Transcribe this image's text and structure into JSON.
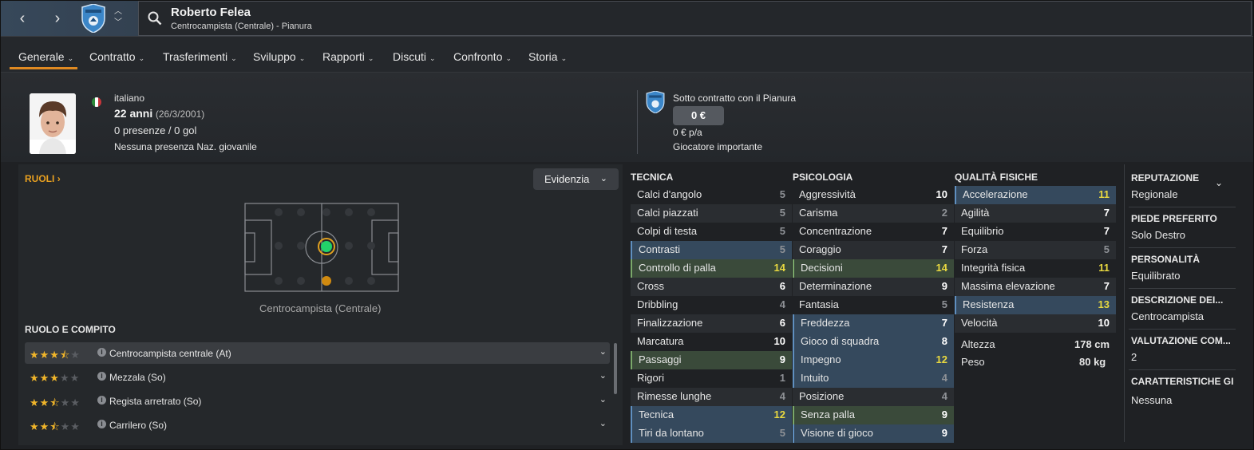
{
  "header": {
    "name": "Roberto Felea",
    "subtitle": "Centrocampista (Centrale) - Pianura"
  },
  "tabs": [
    {
      "label": "Generale"
    },
    {
      "label": "Contratto"
    },
    {
      "label": "Trasferimenti"
    },
    {
      "label": "Sviluppo"
    },
    {
      "label": "Rapporti"
    },
    {
      "label": "Discuti"
    },
    {
      "label": "Confronto"
    },
    {
      "label": "Storia"
    }
  ],
  "bio": {
    "nationality": "italiano",
    "age": "22 anni",
    "dob": "(26/3/2001)",
    "apps": "0 presenze / 0 gol",
    "youth": "Nessuna presenza Naz. giovanile"
  },
  "contract": {
    "club": "Sotto contratto con il Pianura",
    "value": "0 €",
    "wage": "0 € p/a",
    "status": "Giocatore importante"
  },
  "roles": {
    "title": "RUOLI",
    "highlight": "Evidenzia",
    "position_label": "Centrocampista (Centrale)",
    "section_title": "RUOLO E COMPITO",
    "items": [
      {
        "label": "Centrocampista centrale (At)",
        "stars": 3.5
      },
      {
        "label": "Mezzala (So)",
        "stars": 3
      },
      {
        "label": "Regista arretrato (So)",
        "stars": 2.5
      },
      {
        "label": "Carrilero (So)",
        "stars": 2.5
      }
    ]
  },
  "attributes": {
    "tecnica": {
      "title": "TECNICA",
      "items": [
        {
          "name": "Calci d'angolo",
          "value": "5"
        },
        {
          "name": "Calci piazzati",
          "value": "5"
        },
        {
          "name": "Colpi di testa",
          "value": "5"
        },
        {
          "name": "Contrasti",
          "value": "5"
        },
        {
          "name": "Controllo di palla",
          "value": "14"
        },
        {
          "name": "Cross",
          "value": "6"
        },
        {
          "name": "Dribbling",
          "value": "4"
        },
        {
          "name": "Finalizzazione",
          "value": "6"
        },
        {
          "name": "Marcatura",
          "value": "10"
        },
        {
          "name": "Passaggi",
          "value": "9"
        },
        {
          "name": "Rigori",
          "value": "1"
        },
        {
          "name": "Rimesse lunghe",
          "value": "4"
        },
        {
          "name": "Tecnica",
          "value": "12"
        },
        {
          "name": "Tiri da lontano",
          "value": "5"
        }
      ]
    },
    "psicologia": {
      "title": "PSICOLOGIA",
      "items": [
        {
          "name": "Aggressività",
          "value": "10"
        },
        {
          "name": "Carisma",
          "value": "2"
        },
        {
          "name": "Concentrazione",
          "value": "7"
        },
        {
          "name": "Coraggio",
          "value": "7"
        },
        {
          "name": "Decisioni",
          "value": "14"
        },
        {
          "name": "Determinazione",
          "value": "9"
        },
        {
          "name": "Fantasia",
          "value": "5"
        },
        {
          "name": "Freddezza",
          "value": "7"
        },
        {
          "name": "Gioco di squadra",
          "value": "8"
        },
        {
          "name": "Impegno",
          "value": "12"
        },
        {
          "name": "Intuito",
          "value": "4"
        },
        {
          "name": "Posizione",
          "value": "4"
        },
        {
          "name": "Senza palla",
          "value": "9"
        },
        {
          "name": "Visione di gioco",
          "value": "9"
        }
      ]
    },
    "fisiche": {
      "title": "QUALITÀ FISICHE",
      "items": [
        {
          "name": "Accelerazione",
          "value": "11"
        },
        {
          "name": "Agilità",
          "value": "7"
        },
        {
          "name": "Equilibrio",
          "value": "7"
        },
        {
          "name": "Forza",
          "value": "5"
        },
        {
          "name": "Integrità fisica",
          "value": "11"
        },
        {
          "name": "Massima elevazione",
          "value": "7"
        },
        {
          "name": "Resistenza",
          "value": "13"
        },
        {
          "name": "Velocità",
          "value": "10"
        }
      ],
      "height_label": "Altezza",
      "height": "178 cm",
      "weight_label": "Peso",
      "weight": "80 kg"
    }
  },
  "side": [
    {
      "label": "REPUTAZIONE",
      "value": "Regionale"
    },
    {
      "label": "PIEDE PREFERITO",
      "value": "Solo Destro"
    },
    {
      "label": "PERSONALITÀ",
      "value": "Equilibrato"
    },
    {
      "label": "DESCRIZIONE DEI...",
      "value": "Centrocampista"
    },
    {
      "label": "VALUTAZIONE COM...",
      "value": "2"
    },
    {
      "label": "CARATTERISTICHE GI",
      "value": "Nessuna"
    }
  ],
  "colors": {
    "accent": "#e08a22",
    "highlight_value": "#e8d840",
    "key_attr": "#35495d",
    "pref_attr": "#3a4a3a"
  }
}
